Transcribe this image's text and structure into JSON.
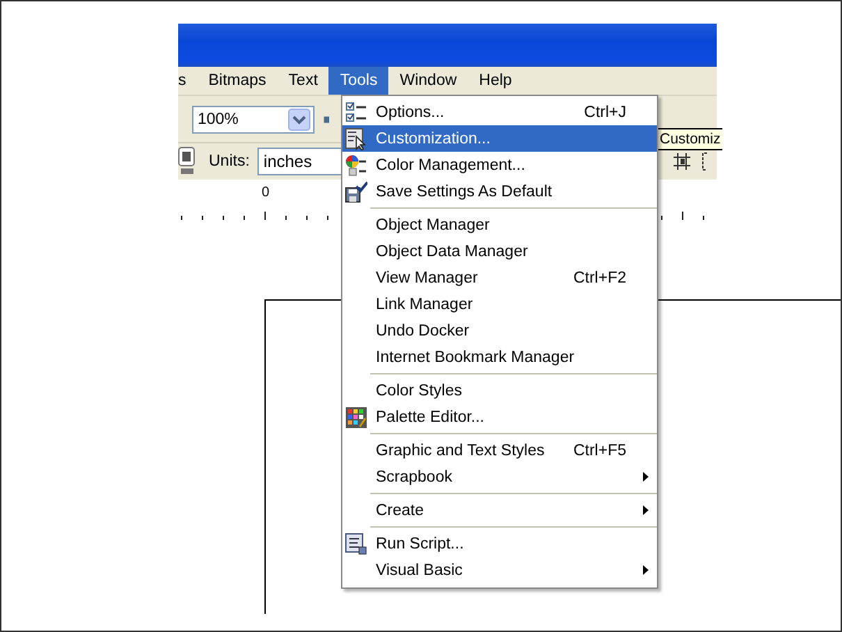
{
  "menu_bar": [
    {
      "label": "s",
      "selected": false
    },
    {
      "label": "Bitmaps",
      "selected": false
    },
    {
      "label": "Text",
      "selected": false
    },
    {
      "label": "Tools",
      "selected": true
    },
    {
      "label": "Window",
      "selected": false
    },
    {
      "label": "Help",
      "selected": false
    }
  ],
  "toolbar": {
    "zoom_combo": {
      "value": "100%"
    },
    "units": {
      "label": "Units:",
      "value": "inches"
    }
  },
  "ruler": {
    "label": "0"
  },
  "tooltip": {
    "text": "Customiz"
  },
  "tools_menu": [
    {
      "kind": "item",
      "label": "Options...",
      "shortcut": "Ctrl+J",
      "submenu": false,
      "selected": false
    },
    {
      "kind": "item",
      "label": "Customization...",
      "submenu": false,
      "selected": true
    },
    {
      "kind": "item",
      "label": "Color Management...",
      "submenu": false,
      "selected": false
    },
    {
      "kind": "item",
      "label": "Save Settings As Default",
      "submenu": false,
      "selected": false
    },
    {
      "kind": "separator"
    },
    {
      "kind": "item",
      "label": "Object Manager",
      "submenu": false,
      "selected": false
    },
    {
      "kind": "item",
      "label": "Object Data Manager",
      "submenu": false,
      "selected": false
    },
    {
      "kind": "item",
      "label": "View Manager",
      "shortcut": "Ctrl+F2",
      "submenu": false,
      "selected": false
    },
    {
      "kind": "item",
      "label": "Link Manager",
      "submenu": false,
      "selected": false
    },
    {
      "kind": "item",
      "label": "Undo Docker",
      "submenu": false,
      "selected": false
    },
    {
      "kind": "item",
      "label": "Internet Bookmark Manager",
      "submenu": false,
      "selected": false
    },
    {
      "kind": "separator"
    },
    {
      "kind": "item",
      "label": "Color Styles",
      "submenu": false,
      "selected": false
    },
    {
      "kind": "item",
      "label": "Palette Editor...",
      "submenu": false,
      "selected": false
    },
    {
      "kind": "separator"
    },
    {
      "kind": "item",
      "label": "Graphic and Text Styles",
      "shortcut": "Ctrl+F5",
      "submenu": false,
      "selected": false
    },
    {
      "kind": "item",
      "label": "Scrapbook",
      "submenu": true,
      "selected": false
    },
    {
      "kind": "separator"
    },
    {
      "kind": "item",
      "label": "Create",
      "submenu": true,
      "selected": false
    },
    {
      "kind": "separator"
    },
    {
      "kind": "item",
      "label": "Run Script...",
      "submenu": false,
      "selected": false
    },
    {
      "kind": "item",
      "label": "Visual Basic",
      "submenu": true,
      "selected": false
    }
  ]
}
